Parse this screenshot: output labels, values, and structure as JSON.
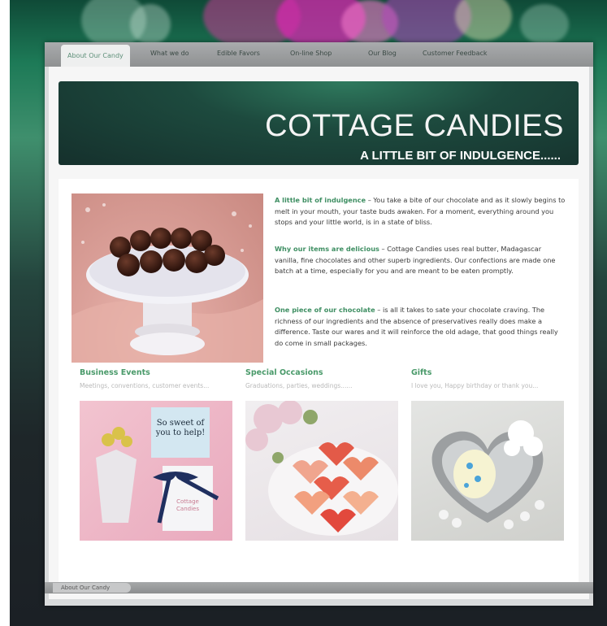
{
  "nav": {
    "items": [
      {
        "label": "About Our Candy",
        "active": true
      },
      {
        "label": "What we do"
      },
      {
        "label": "Edible Favors"
      },
      {
        "label": "On-line Shop"
      },
      {
        "label": "Our Blog"
      },
      {
        "label": "Customer Feedback"
      }
    ]
  },
  "header": {
    "title": "COTTAGE CANDIES",
    "tagline": "A LITTLE BIT OF INDULGENCE......"
  },
  "intro": [
    {
      "heading": "A little bit of indulgence",
      "text": " – You take a bite of our chocolate and as it slowly begins to melt in your mouth, your taste buds awaken. For a moment, everything around you stops and your little world, is in a state of bliss."
    },
    {
      "heading": "Why our items are delicious",
      "text": " – Cottage Candies uses real butter, Madagascar vanilla, fine chocolates and other superb ingredients. Our confections are made one batch at a time, especially for you and are meant to be eaten promptly."
    },
    {
      "heading": "One piece of our chocolate",
      "text": " – is all it takes to sate your chocolate craving. The richness of our ingredients and the absence of preservatives really does make a difference. Taste our wares and it will reinforce the old adage, that good things really do come in small packages."
    }
  ],
  "columns": [
    {
      "title": "Business Events",
      "subtitle": "Meetings, conventions, customer events..."
    },
    {
      "title": "Special Occasions",
      "subtitle": "Graduations, parties, weddings......"
    },
    {
      "title": "Gifts",
      "subtitle": "I love you, Happy birthday or thank you..."
    }
  ],
  "photos": {
    "gift_card": "So sweet of you to help!",
    "box_label": "Cottage Candies"
  },
  "footer": {
    "tab_label": "About Our Candy"
  },
  "colors": {
    "accent_green": "#4a9a6a",
    "header_bg": "#1d4a3e"
  }
}
